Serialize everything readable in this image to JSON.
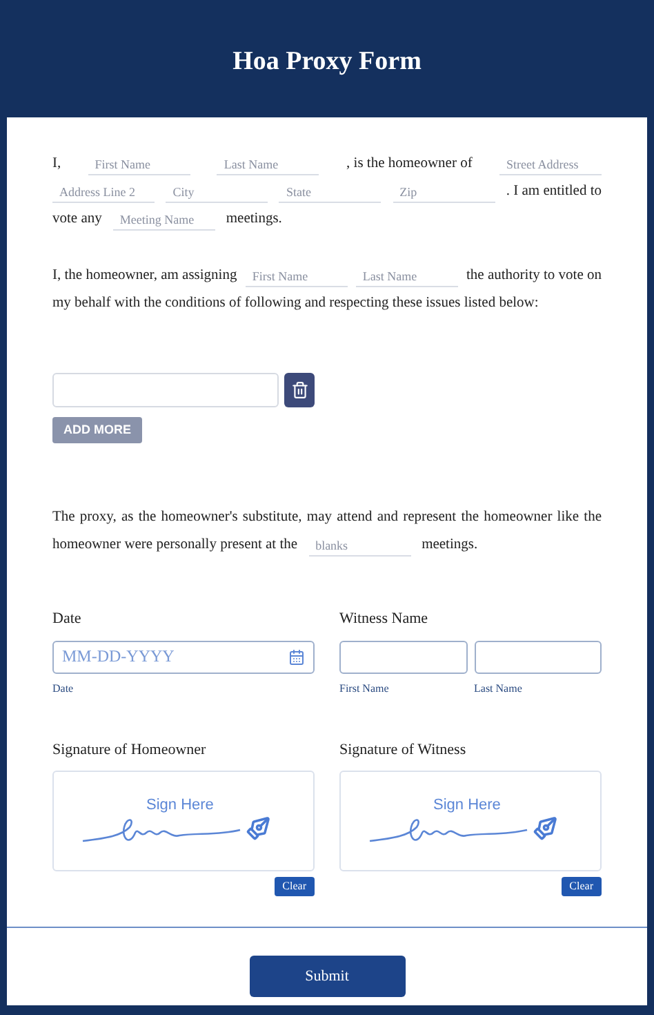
{
  "title": "Hoa Proxy Form",
  "intro": {
    "lines": [
      [
        {
          "kind": "text",
          "text": "I,"
        },
        {
          "kind": "field",
          "placeholder": "First Name"
        },
        {
          "kind": "field",
          "placeholder": "Last Name"
        },
        {
          "kind": "text",
          "text": ", is the homeowner of"
        },
        {
          "kind": "field",
          "placeholder": "Street Address"
        }
      ],
      [
        {
          "kind": "field",
          "placeholder": "Address Line 2"
        },
        {
          "kind": "field",
          "placeholder": "City"
        },
        {
          "kind": "field",
          "placeholder": "State"
        },
        {
          "kind": "field",
          "placeholder": "Zip"
        },
        {
          "kind": "text",
          "text": ". I am entitled to"
        }
      ],
      [
        {
          "kind": "text",
          "text": "vote any"
        },
        {
          "kind": "field",
          "placeholder": "Meeting Name"
        },
        {
          "kind": "text",
          "text": "meetings."
        }
      ]
    ]
  },
  "assign": {
    "lines": [
      [
        {
          "kind": "text",
          "text": "I, the homeowner, am assigning"
        },
        {
          "kind": "field",
          "placeholder": "First Name"
        },
        {
          "kind": "field",
          "placeholder": "Last Name"
        },
        {
          "kind": "text",
          "text": "the authority to vote on"
        }
      ],
      [
        {
          "kind": "text",
          "text": "my behalf with the conditions of following and respecting these issues listed below:"
        }
      ]
    ]
  },
  "issues": [
    {
      "kind": "text"
    }
  ],
  "add_button": {
    "label": "ADD MORE",
    "disabled": true
  },
  "proxy": {
    "lines": [
      [
        {
          "kind": "text",
          "text": "The proxy, as the homeowner's substitute, may attend and represent the homeowner like the"
        }
      ],
      [
        {
          "kind": "text",
          "text": "homeowner were personally present at the"
        },
        {
          "kind": "field",
          "placeholder": "blanks"
        },
        {
          "kind": "text",
          "text": "meetings."
        }
      ]
    ]
  },
  "date": {
    "label": "Date",
    "placeholder": "MM-DD-YYYY",
    "sublabel": "Date"
  },
  "witness": {
    "label": "Witness Name",
    "fields": [
      {
        "sublabel": "First Name"
      },
      {
        "sublabel": "Last Name"
      }
    ]
  },
  "signatures": [
    {
      "label": "Signature of Homeowner",
      "prompt": "Sign Here",
      "clear": "Clear"
    },
    {
      "label": "Signature of Witness",
      "prompt": "Sign Here",
      "clear": "Clear"
    }
  ],
  "submit": "Submit"
}
